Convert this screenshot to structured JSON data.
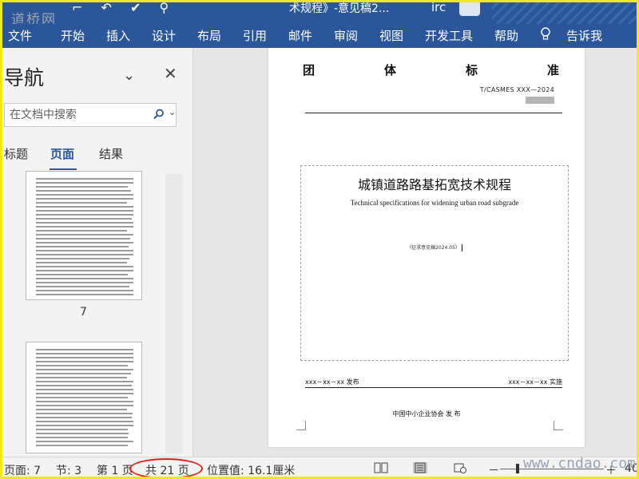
{
  "watermarks": {
    "top_left": "道桥网",
    "bottom_right": "www.cndao.com"
  },
  "titlebar": {
    "doc_title": "术规程》-意见稿2...",
    "user": "irc",
    "qat_icons": [
      "save-icon",
      "undo-icon",
      "check-icon",
      "search-icon"
    ]
  },
  "ribbon": {
    "tabs": [
      "文件",
      "开始",
      "插入",
      "设计",
      "布局",
      "引用",
      "邮件",
      "审阅",
      "视图",
      "开发工具",
      "帮助"
    ],
    "tell_me": "告诉我"
  },
  "nav": {
    "title": "导航",
    "search_placeholder": "在文档中搜索",
    "tabs": [
      "标题",
      "页面",
      "结果"
    ],
    "active_tab": "页面",
    "thumbnails": [
      {
        "number": "7"
      },
      {
        "number": ""
      }
    ]
  },
  "document": {
    "header_chars": [
      "团",
      "体",
      "标",
      "准"
    ],
    "std_code": "T/CASMES XXX—2024",
    "title_cn": "城镇道路路基拓宽技术规程",
    "title_en": "Technical specifications for widening urban road subgrade",
    "draft_note": "（征求意见稿2024.05）",
    "publish": "xxx－xx－xx 发布",
    "implement": "xxx－xx－xx 实施",
    "org": "中国中小企业协会  发 布"
  },
  "status": {
    "page": "页面: 7",
    "section": "节: 3",
    "page_of": "第 1 页",
    "total": "共 21 页",
    "position": "位置值: 16.1厘米",
    "zoom_minus": "－",
    "zoom_plus": "＋",
    "zoom_level": "40"
  },
  "colors": {
    "ribbon": "#2b579a",
    "highlight_oval": "#e0201a",
    "frame": "#f2e71a"
  }
}
